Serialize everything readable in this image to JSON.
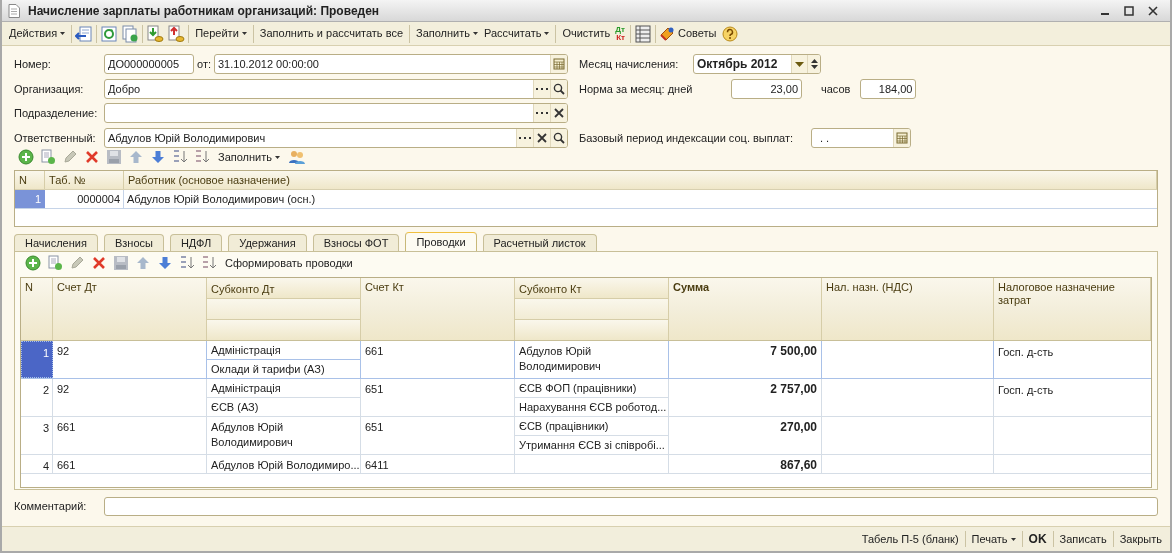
{
  "window": {
    "title": "Начисление зарплаты работникам организаций: Проведен"
  },
  "toolbar": [
    {
      "kind": "menu",
      "label": "Действия"
    },
    {
      "kind": "menu",
      "label": "Перейти"
    },
    {
      "kind": "button",
      "label": "Заполнить и рассчитать все"
    },
    {
      "kind": "menu",
      "label": "Заполнить"
    },
    {
      "kind": "menu",
      "label": "Рассчитать"
    },
    {
      "kind": "button",
      "label": "Очистить"
    },
    {
      "kind": "stacked",
      "label": "Дт",
      "sublabel": "Кт"
    },
    {
      "kind": "button",
      "label": "Советы"
    }
  ],
  "header": {
    "number": {
      "label": "Номер:",
      "value": "ДО000000005"
    },
    "date": {
      "label": "от:",
      "value": "31.10.2012 00:00:00"
    },
    "organization": {
      "label": "Организация:",
      "value": "Добро"
    },
    "department": {
      "label": "Подразделение:"
    },
    "responsible": {
      "label": "Ответственный:",
      "value": "Абдулов Юрій Володимирович"
    },
    "month": {
      "label": "Месяц начисления:",
      "value": "Октябрь 2012"
    },
    "norm": {
      "label": "Норма за месяц: дней",
      "days": "23,00",
      "hours_label": "часов",
      "hours": "184,00"
    },
    "base_period": {
      "label": "Базовый период индексации соц. выплат:",
      "value": ". ."
    }
  },
  "workers": {
    "toolbar": {
      "fill_label": "Заполнить"
    },
    "columns": [
      "N",
      "Таб. №",
      "Работник (основое назначение)"
    ],
    "rows": [
      {
        "n": "1",
        "tab_no": "0000004",
        "worker": "Абдулов Юрій Володимирович (осн.)",
        "selected": true
      }
    ]
  },
  "tabs": [
    {
      "label": "Начисления",
      "selected": false
    },
    {
      "label": "Взносы",
      "selected": false
    },
    {
      "label": "НДФЛ",
      "selected": false
    },
    {
      "label": "Удержания",
      "selected": false
    },
    {
      "label": "Взносы ФОТ",
      "selected": false
    },
    {
      "label": "Проводки",
      "selected": true
    },
    {
      "label": "Расчетный листок",
      "selected": false
    }
  ],
  "entries": {
    "toolbar": {
      "generate_label": "Сформировать проводки"
    },
    "columns": [
      "N",
      "Счет Дт",
      "Субконто Дт",
      "Счет Кт",
      "Субконто Кт",
      "Сумма",
      "Нал. назн. (НДС)",
      "Налоговое назначение затрат"
    ],
    "rows": [
      {
        "n": "1",
        "account_dt": "92",
        "subconto_dt": [
          "Адміністрація",
          "Оклади й тарифи (АЗ)"
        ],
        "account_kt": "661",
        "subconto_kt": [
          "Абдулов Юрій Володимирович"
        ],
        "sum": "7 500,00",
        "tax_purpose": "Госп. д-сть",
        "selected": true
      },
      {
        "n": "2",
        "account_dt": "92",
        "subconto_dt": [
          "Адміністрація",
          "ЄСВ (АЗ)"
        ],
        "account_kt": "651",
        "subconto_kt": [
          "ЄСВ ФОП (працівники)",
          "Нарахування ЄСВ роботод..."
        ],
        "sum": "2 757,00",
        "tax_purpose": "Госп. д-сть",
        "selected": false
      },
      {
        "n": "3",
        "account_dt": "661",
        "subconto_dt": [
          "Абдулов Юрій Володимирович"
        ],
        "account_kt": "651",
        "subconto_kt": [
          "ЄСВ (працівники)",
          "Утримання ЄСВ зі співробі..."
        ],
        "sum": "270,00",
        "selected": false
      },
      {
        "n": "4",
        "account_dt": "661",
        "subconto_dt": [
          "Абдулов Юрій Володимиро..."
        ],
        "account_kt": "6411",
        "subconto_kt": [],
        "sum": "867,60",
        "selected": false
      }
    ]
  },
  "comment": {
    "label": "Комментарий:"
  },
  "footer": [
    {
      "kind": "button",
      "label": "Табель П-5 (бланк)"
    },
    {
      "kind": "menu",
      "label": "Печать"
    },
    {
      "kind": "default",
      "label": "OK"
    },
    {
      "kind": "button",
      "label": "Записать"
    },
    {
      "kind": "button",
      "label": "Закрыть"
    }
  ]
}
